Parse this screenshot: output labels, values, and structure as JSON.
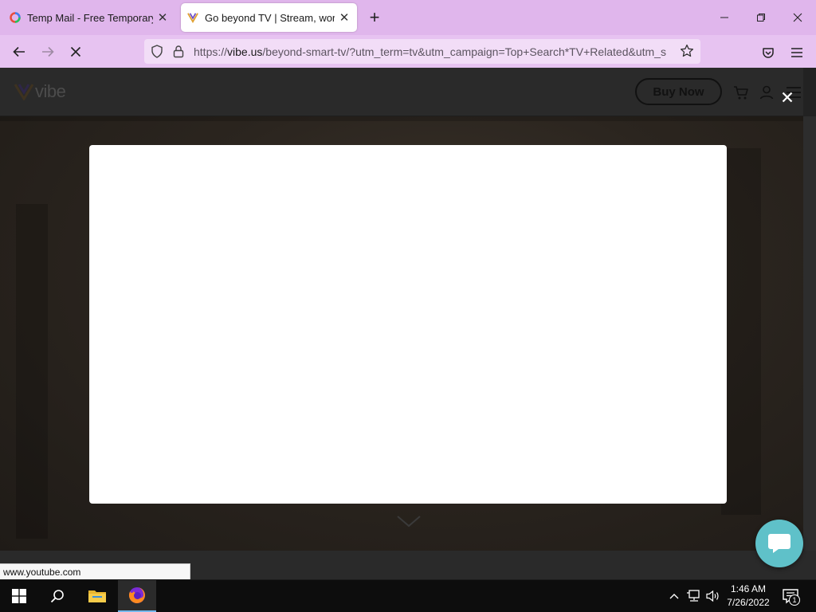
{
  "browser": {
    "tabs": [
      {
        "title": "Temp Mail - Free Temporary Em",
        "favicon": "tempmail-favicon",
        "active": false
      },
      {
        "title": "Go beyond TV | Stream, work, an",
        "favicon": "vibe-favicon",
        "active": true
      }
    ],
    "new_tab_icon": "plus-icon",
    "window_controls": [
      "minimize-icon",
      "maximize-icon",
      "close-icon"
    ],
    "nav": {
      "back_icon": "arrow-left-icon",
      "forward_icon": "arrow-right-icon",
      "stop_icon": "stop-icon"
    },
    "url": {
      "prefix": "https://",
      "domain": "vibe.us",
      "path": "/beyond-smart-tv/?utm_term=tv&utm_campaign=Top+Search*TV+Related&utm_s"
    },
    "toolbar_icons": [
      "shield-icon",
      "lock-icon",
      "star-icon",
      "pocket-icon",
      "hamburger-menu-icon"
    ]
  },
  "page": {
    "logo_text": "vibe",
    "buy_now_label": "Buy Now",
    "header_icons": [
      "cart-icon",
      "user-icon",
      "hamburger-icon"
    ],
    "modal_close_icon": "close-icon",
    "scroll_indicator_icon": "chevron-down-icon",
    "chat_icon": "chat-bubble-icon",
    "colors": {
      "chat_bubble": "#5fc1c9",
      "browser_chrome": "#e0b6ec",
      "overlay": "#1c1c1c"
    }
  },
  "status_bar": {
    "hover_url": "www.youtube.com"
  },
  "taskbar": {
    "apps": [
      "windows-start-icon",
      "search-icon",
      "file-explorer-icon",
      "firefox-icon"
    ],
    "tray_icons": [
      "chevron-up-icon",
      "network-icon",
      "volume-icon"
    ],
    "time": "1:46 AM",
    "date": "7/26/2022",
    "notification_count": "1"
  }
}
